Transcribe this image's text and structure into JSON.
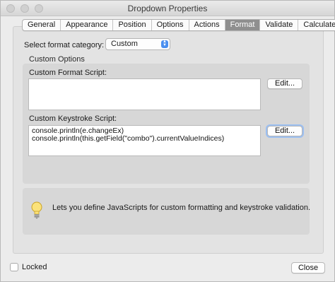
{
  "window": {
    "title": "Dropdown Properties"
  },
  "tabs": [
    {
      "label": "General",
      "active": false
    },
    {
      "label": "Appearance",
      "active": false
    },
    {
      "label": "Position",
      "active": false
    },
    {
      "label": "Options",
      "active": false
    },
    {
      "label": "Actions",
      "active": false
    },
    {
      "label": "Format",
      "active": true
    },
    {
      "label": "Validate",
      "active": false
    },
    {
      "label": "Calculate",
      "active": false
    }
  ],
  "format": {
    "category_label": "Select format category:",
    "category_value": "Custom"
  },
  "custom_options": {
    "title": "Custom Options",
    "format_script_label": "Custom Format Script:",
    "format_script_lines": [],
    "keystroke_script_label": "Custom Keystroke Script:",
    "keystroke_script_lines": [
      "console.println(e.changeEx)",
      "console.println(this.getField(\"combo\").currentValueIndices)"
    ],
    "edit_label": "Edit..."
  },
  "info": {
    "text": "Lets you define JavaScripts for custom formatting and keystroke validation.",
    "icon": "lightbulb-icon"
  },
  "footer": {
    "locked_label": "Locked",
    "locked_checked": false,
    "close_label": "Close"
  },
  "colors": {
    "active_tab": "#8f8f8f",
    "select_arrow": "#4a8ff0",
    "focus_ring": "#9cbff1"
  }
}
